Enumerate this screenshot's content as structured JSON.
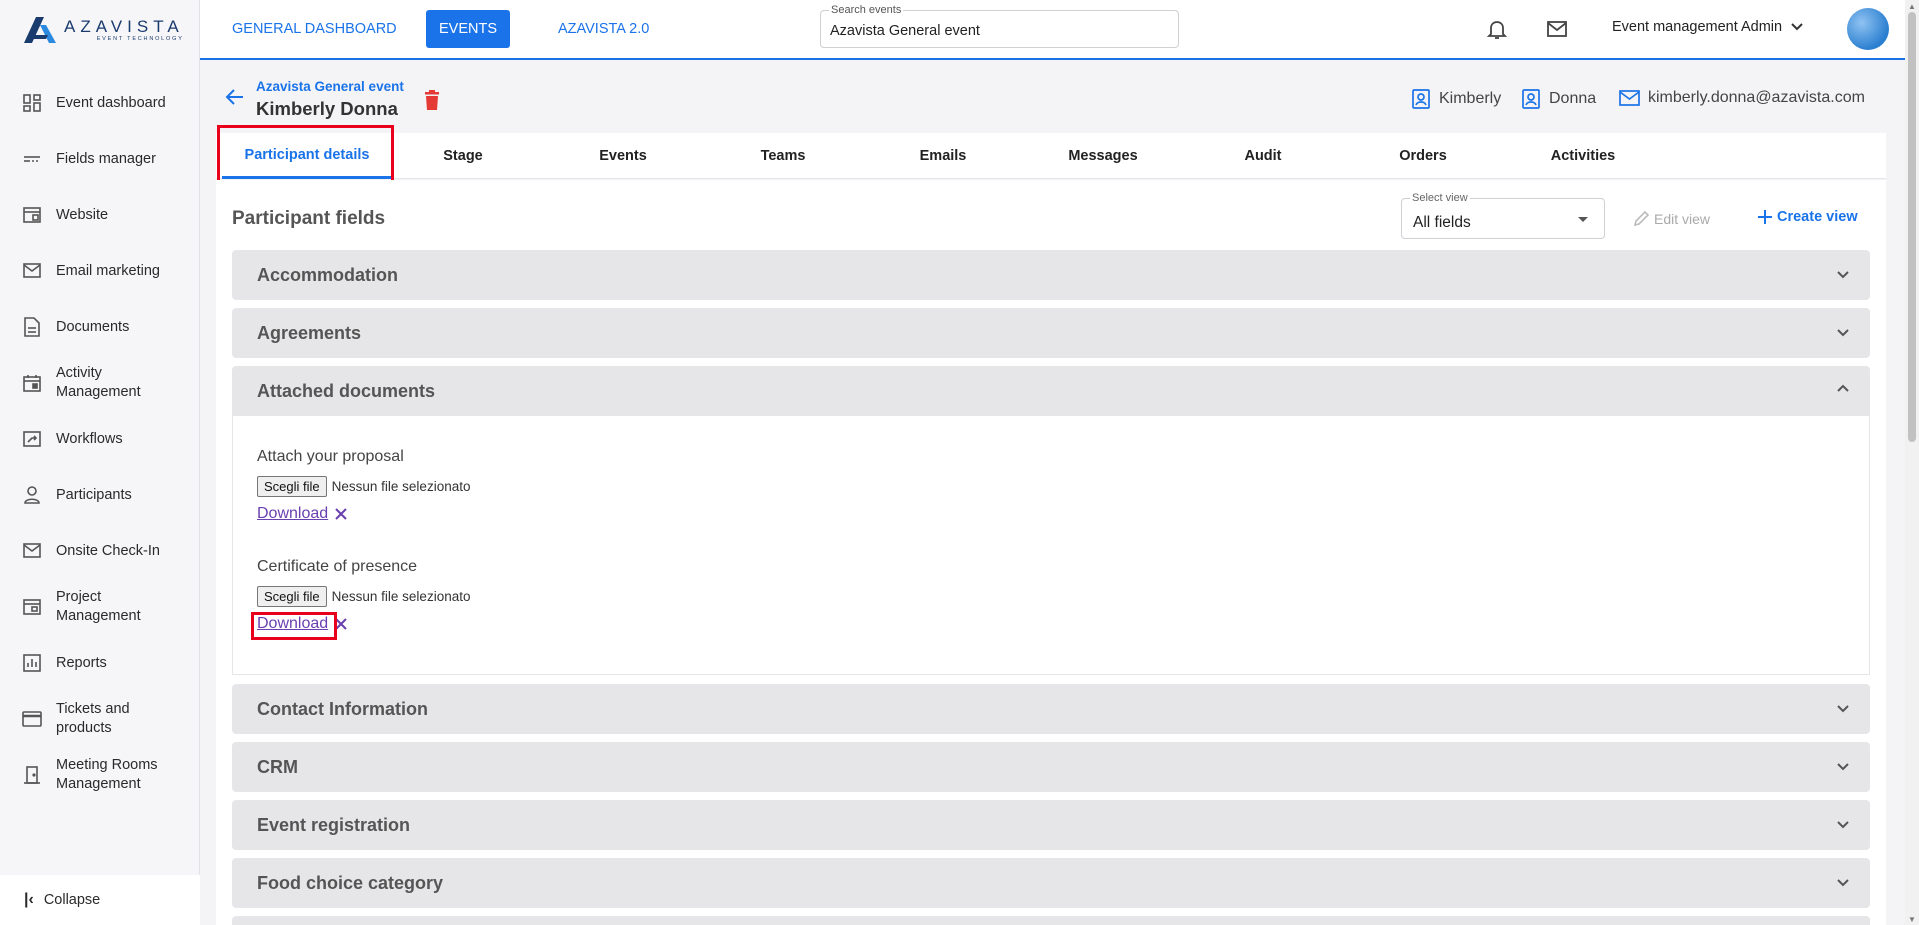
{
  "brand": {
    "name": "AZAVISTA",
    "tagline": "EVENT TECHNOLOGY"
  },
  "sidebar": {
    "items": [
      {
        "label": "Event dashboard",
        "icon": "dashboard-icon"
      },
      {
        "label": "Fields manager",
        "icon": "fields-icon"
      },
      {
        "label": "Website",
        "icon": "website-icon"
      },
      {
        "label": "Email marketing",
        "icon": "mail-icon"
      },
      {
        "label": "Documents",
        "icon": "document-icon"
      },
      {
        "label": "Activity Management",
        "icon": "calendar-icon"
      },
      {
        "label": "Workflows",
        "icon": "workflow-icon"
      },
      {
        "label": "Participants",
        "icon": "person-icon"
      },
      {
        "label": "Onsite Check-In",
        "icon": "mail-icon"
      },
      {
        "label": "Project Management",
        "icon": "project-icon"
      },
      {
        "label": "Reports",
        "icon": "chart-icon"
      },
      {
        "label": "Tickets and products",
        "icon": "card-icon"
      },
      {
        "label": "Meeting Rooms Management",
        "icon": "door-icon"
      }
    ],
    "collapse_label": "Collapse"
  },
  "topbar": {
    "tabs": [
      "GENERAL DASHBOARD",
      "EVENTS",
      "AZAVISTA 2.0"
    ],
    "search_label": "Search events",
    "search_value": "Azavista General event",
    "user_name": "Event management Admin"
  },
  "header": {
    "event_name": "Azavista General event",
    "participant_name": "Kimberly Donna",
    "first_name": "Kimberly",
    "last_name": "Donna",
    "email": "kimberly.donna@azavista.com"
  },
  "tabs": [
    "Participant details",
    "Stage",
    "Events",
    "Teams",
    "Emails",
    "Messages",
    "Audit",
    "Orders",
    "Activities"
  ],
  "fields_section": {
    "title": "Participant fields",
    "select_view_label": "Select view",
    "select_view_value": "All fields",
    "edit_view": "Edit view",
    "create_view": "Create view"
  },
  "accordions": {
    "accommodation": "Accommodation",
    "agreements": "Agreements",
    "attached_documents": "Attached documents",
    "contact_information": "Contact Information",
    "crm": "CRM",
    "event_registration": "Event registration",
    "food_choice": "Food choice category"
  },
  "attached": {
    "field1_label": "Attach your proposal",
    "field2_label": "Certificate of presence",
    "choose_file": "Scegli file",
    "no_file": "Nessun file selezionato",
    "download": "Download"
  },
  "colors": {
    "accent": "#1a73e8",
    "danger": "#e53935",
    "highlight": "#e8001c",
    "link": "#6a3fb0"
  }
}
